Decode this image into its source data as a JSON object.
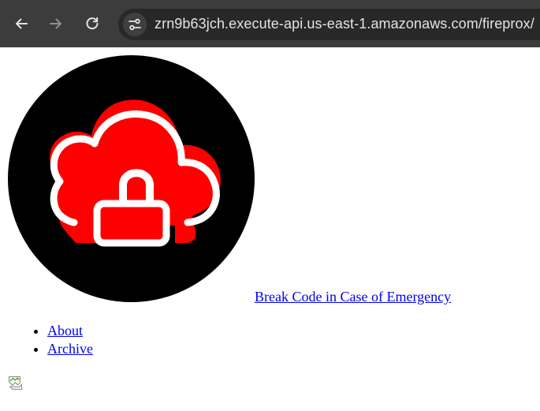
{
  "browser": {
    "url": "zrn9b63jch.execute-api.us-east-1.amazonaws.com/fireprox/",
    "icons": {
      "back": "arrow-left-icon",
      "forward": "arrow-right-icon",
      "reload": "reload-icon",
      "site_info": "tune-icon"
    }
  },
  "page": {
    "logo_icon": "cloud-lock-logo",
    "title_link": "Break Code in Case of Emergency",
    "nav_items": [
      {
        "label": "About"
      },
      {
        "label": "Archive"
      }
    ],
    "broken_image_icon": "broken-image-icon"
  },
  "colors": {
    "toolbar_bg": "#3c3c3c",
    "omnibox_bg": "#282828",
    "logo_red": "#ff0000",
    "link": "#0000ee"
  }
}
